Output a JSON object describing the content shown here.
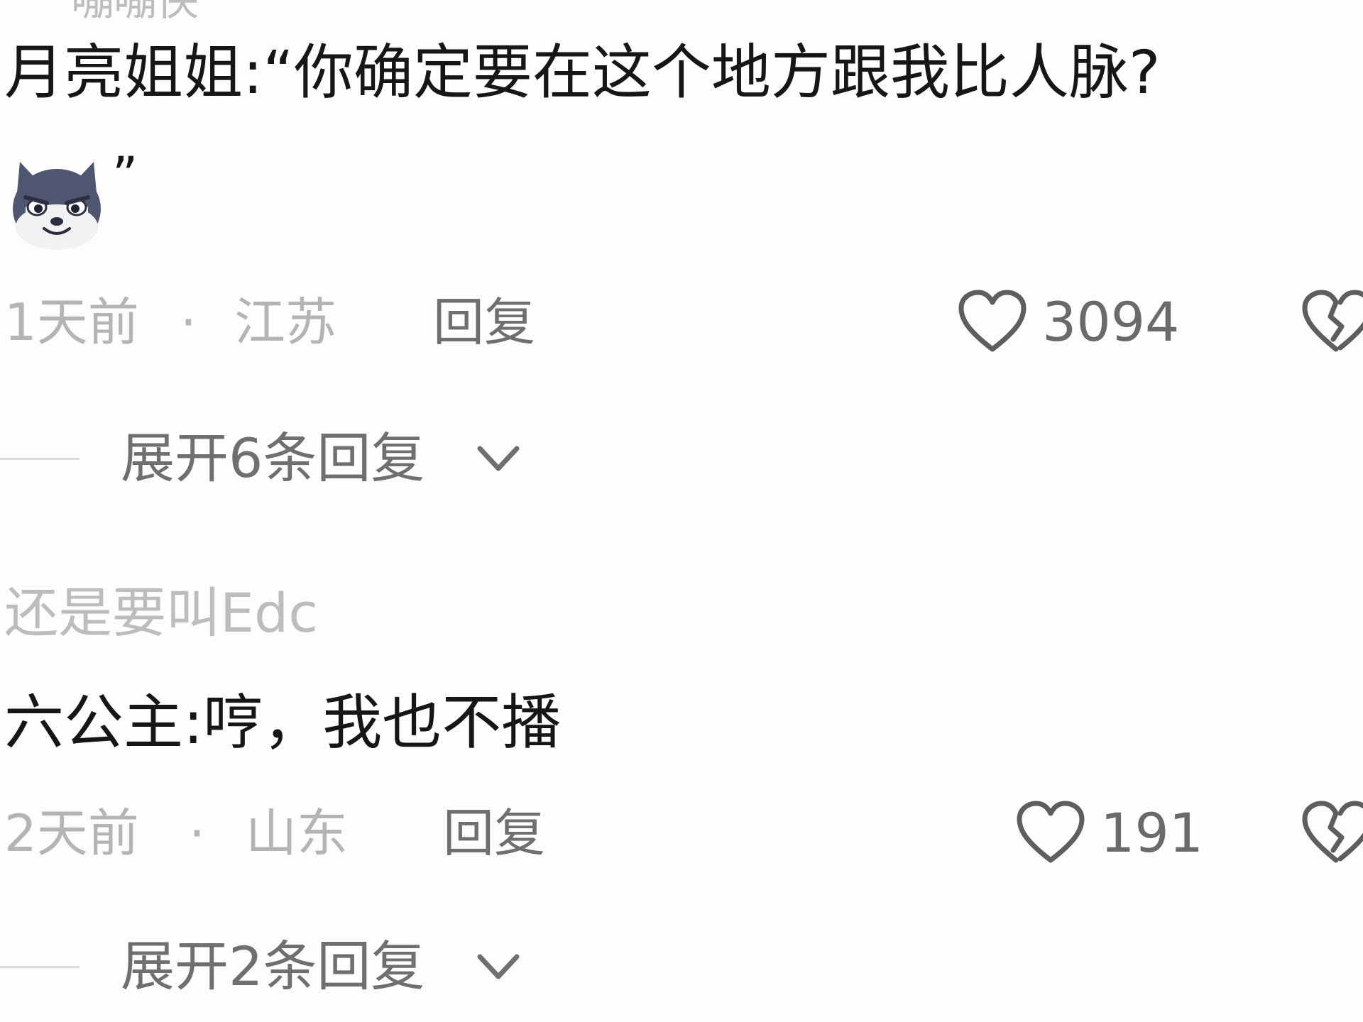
{
  "prev_username_fragment": "嘣嘣侠",
  "comments": [
    {
      "text": "月亮姐姐:“你确定要在这个地方跟我比人脉?",
      "close_quote": "”",
      "emoji": "dog-emoji",
      "time": "1天前",
      "separator": "·",
      "location": "江苏",
      "reply_label": "回复",
      "likes": "3094",
      "expand_label": "展开6条回复"
    },
    {
      "username": "还是要叫Edc",
      "text": "六公主:哼，我也不播",
      "time": "2天前",
      "separator": "·",
      "location": "山东",
      "reply_label": "回复",
      "likes": "191",
      "expand_label": "展开2条回复"
    }
  ],
  "colors": {
    "text": "#161616",
    "meta": "#b4b4b4",
    "action": "#6f6f6f",
    "background": "#fdfdfd"
  },
  "icons": [
    "heart-outline-icon",
    "broken-heart-icon",
    "chevron-down-icon",
    "dog-emoji"
  ]
}
